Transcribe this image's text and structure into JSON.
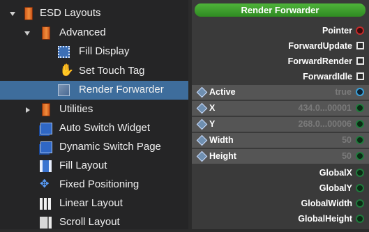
{
  "tree": {
    "items": [
      {
        "label": "ESD Layouts",
        "icon": "folder-icon",
        "depth": 0,
        "expanded": true
      },
      {
        "label": "Advanced",
        "icon": "folder-icon",
        "depth": 1,
        "expanded": true
      },
      {
        "label": "Fill Display",
        "icon": "fill-display-icon",
        "depth": 2
      },
      {
        "label": "Set Touch Tag",
        "icon": "touch-hand-icon",
        "depth": 2
      },
      {
        "label": "Render Forwarder",
        "icon": "render-forwarder-icon",
        "depth": 2,
        "selected": true
      },
      {
        "label": "Utilities",
        "icon": "folder-icon",
        "depth": 1,
        "expanded": false
      },
      {
        "label": "Auto Switch Widget",
        "icon": "widget-icon",
        "depth": 1
      },
      {
        "label": "Dynamic Switch Page",
        "icon": "widget-icon",
        "depth": 1
      },
      {
        "label": "Fill Layout",
        "icon": "fill-layout-icon",
        "depth": 1
      },
      {
        "label": "Fixed Positioning",
        "icon": "fixed-positioning-icon",
        "depth": 1
      },
      {
        "label": "Linear Layout",
        "icon": "linear-layout-icon",
        "depth": 1
      },
      {
        "label": "Scroll Layout",
        "icon": "scroll-layout-icon",
        "depth": 1
      }
    ]
  },
  "node": {
    "title": "Render Forwarder",
    "title_color": "#3fa02f",
    "top_outputs": [
      {
        "label": "Pointer",
        "port": "circle-red"
      },
      {
        "label": "ForwardUpdate",
        "port": "square"
      },
      {
        "label": "ForwardRender",
        "port": "square"
      },
      {
        "label": "ForwardIdle",
        "port": "square"
      }
    ],
    "inputs": [
      {
        "label": "Active",
        "value": "true",
        "port": "circle-blue"
      },
      {
        "label": "X",
        "value": "434.0...00001",
        "port": "circle-green"
      },
      {
        "label": "Y",
        "value": "268.0...00006",
        "port": "circle-green"
      },
      {
        "label": "Width",
        "value": "50",
        "port": "circle-green"
      },
      {
        "label": "Height",
        "value": "50",
        "port": "circle-green"
      }
    ],
    "bottom_outputs": [
      {
        "label": "GlobalX",
        "port": "circle-green"
      },
      {
        "label": "GlobalY",
        "port": "circle-green"
      },
      {
        "label": "GlobalWidth",
        "port": "circle-green"
      },
      {
        "label": "GlobalHeight",
        "port": "circle-green"
      }
    ]
  }
}
